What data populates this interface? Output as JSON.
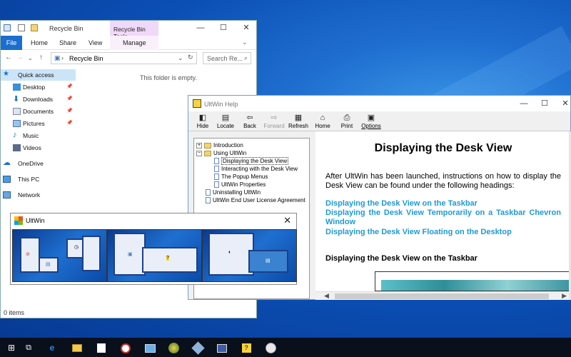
{
  "explorer": {
    "title": "Recycle Bin",
    "contextual_tab": "Recycle Bin Tools",
    "ribbon": {
      "file": "File",
      "home": "Home",
      "share": "Share",
      "view": "View",
      "manage": "Manage"
    },
    "address": "Recycle Bin",
    "search_placeholder": "Search Re...",
    "empty_message": "This folder is empty.",
    "status": "0 items",
    "sidebar": [
      {
        "label": "Quick access",
        "icon": "star-icon",
        "pinned": false
      },
      {
        "label": "Desktop",
        "icon": "desktop-folder-icon",
        "pinned": true
      },
      {
        "label": "Downloads",
        "icon": "download-icon",
        "pinned": true
      },
      {
        "label": "Documents",
        "icon": "documents-icon",
        "pinned": true
      },
      {
        "label": "Pictures",
        "icon": "pictures-icon",
        "pinned": true
      },
      {
        "label": "Music",
        "icon": "music-icon",
        "pinned": false
      },
      {
        "label": "Videos",
        "icon": "videos-icon",
        "pinned": false
      },
      {
        "label": "OneDrive",
        "icon": "cloud-icon",
        "pinned": false
      },
      {
        "label": "This PC",
        "icon": "computer-icon",
        "pinned": false
      },
      {
        "label": "Network",
        "icon": "network-icon",
        "pinned": false
      }
    ]
  },
  "help": {
    "title": "UltWin Help",
    "toolbar": [
      {
        "label": "Hide",
        "icon": "hide-icon",
        "enabled": true
      },
      {
        "label": "Locate",
        "icon": "locate-icon",
        "enabled": true
      },
      {
        "label": "Back",
        "icon": "back-arrow-icon",
        "enabled": true
      },
      {
        "label": "Forward",
        "icon": "forward-arrow-icon",
        "enabled": false
      },
      {
        "label": "Refresh",
        "icon": "refresh-icon",
        "enabled": true
      },
      {
        "label": "Home",
        "icon": "home-icon",
        "enabled": true
      },
      {
        "label": "Print",
        "icon": "print-icon",
        "enabled": true
      },
      {
        "label": "Options",
        "icon": "options-icon",
        "enabled": true
      }
    ],
    "toc": [
      {
        "label": "Introduction",
        "type": "book",
        "toggle": "+",
        "level": 0
      },
      {
        "label": "Using UltWin",
        "type": "book",
        "toggle": "−",
        "level": 0
      },
      {
        "label": "Displaying the Desk View",
        "type": "page",
        "level": 1,
        "selected": true
      },
      {
        "label": "Interacting with the Desk View",
        "type": "page",
        "level": 1
      },
      {
        "label": "The Popup Menus",
        "type": "page",
        "level": 1
      },
      {
        "label": "UltWin Properties",
        "type": "page",
        "level": 1
      },
      {
        "label": "Uninstalling UltWin",
        "type": "page",
        "level": 0
      },
      {
        "label": "UltWin End User License Agreement",
        "type": "page",
        "level": 0
      }
    ],
    "content": {
      "heading": "Displaying the Desk View",
      "intro": "After UltWin has been launched, instructions on how to display the Desk View can be found under the following headings:",
      "links": [
        "Displaying the Desk View on the Taskbar",
        "Displaying the Desk View Temporarily on a Taskbar Chevron Window",
        "Displaying the Desk View Floating on the Desktop"
      ],
      "subheading": "Displaying the Desk View on the Taskbar"
    }
  },
  "ultwin": {
    "title": "UltWin"
  },
  "taskbar": {
    "items": [
      "start-icon",
      "task-view-icon",
      "edge-icon",
      "file-explorer-icon",
      "store-icon",
      "ultwin-icon",
      "app-icon",
      "globe-icon",
      "pen-icon",
      "desk-icon",
      "help-icon",
      "clock-icon"
    ]
  },
  "colors": {
    "accent": "#1a6fce",
    "link": "#1e9ad6",
    "desktop": "#0b4fb5",
    "taskbar": "#0a0f1c"
  }
}
